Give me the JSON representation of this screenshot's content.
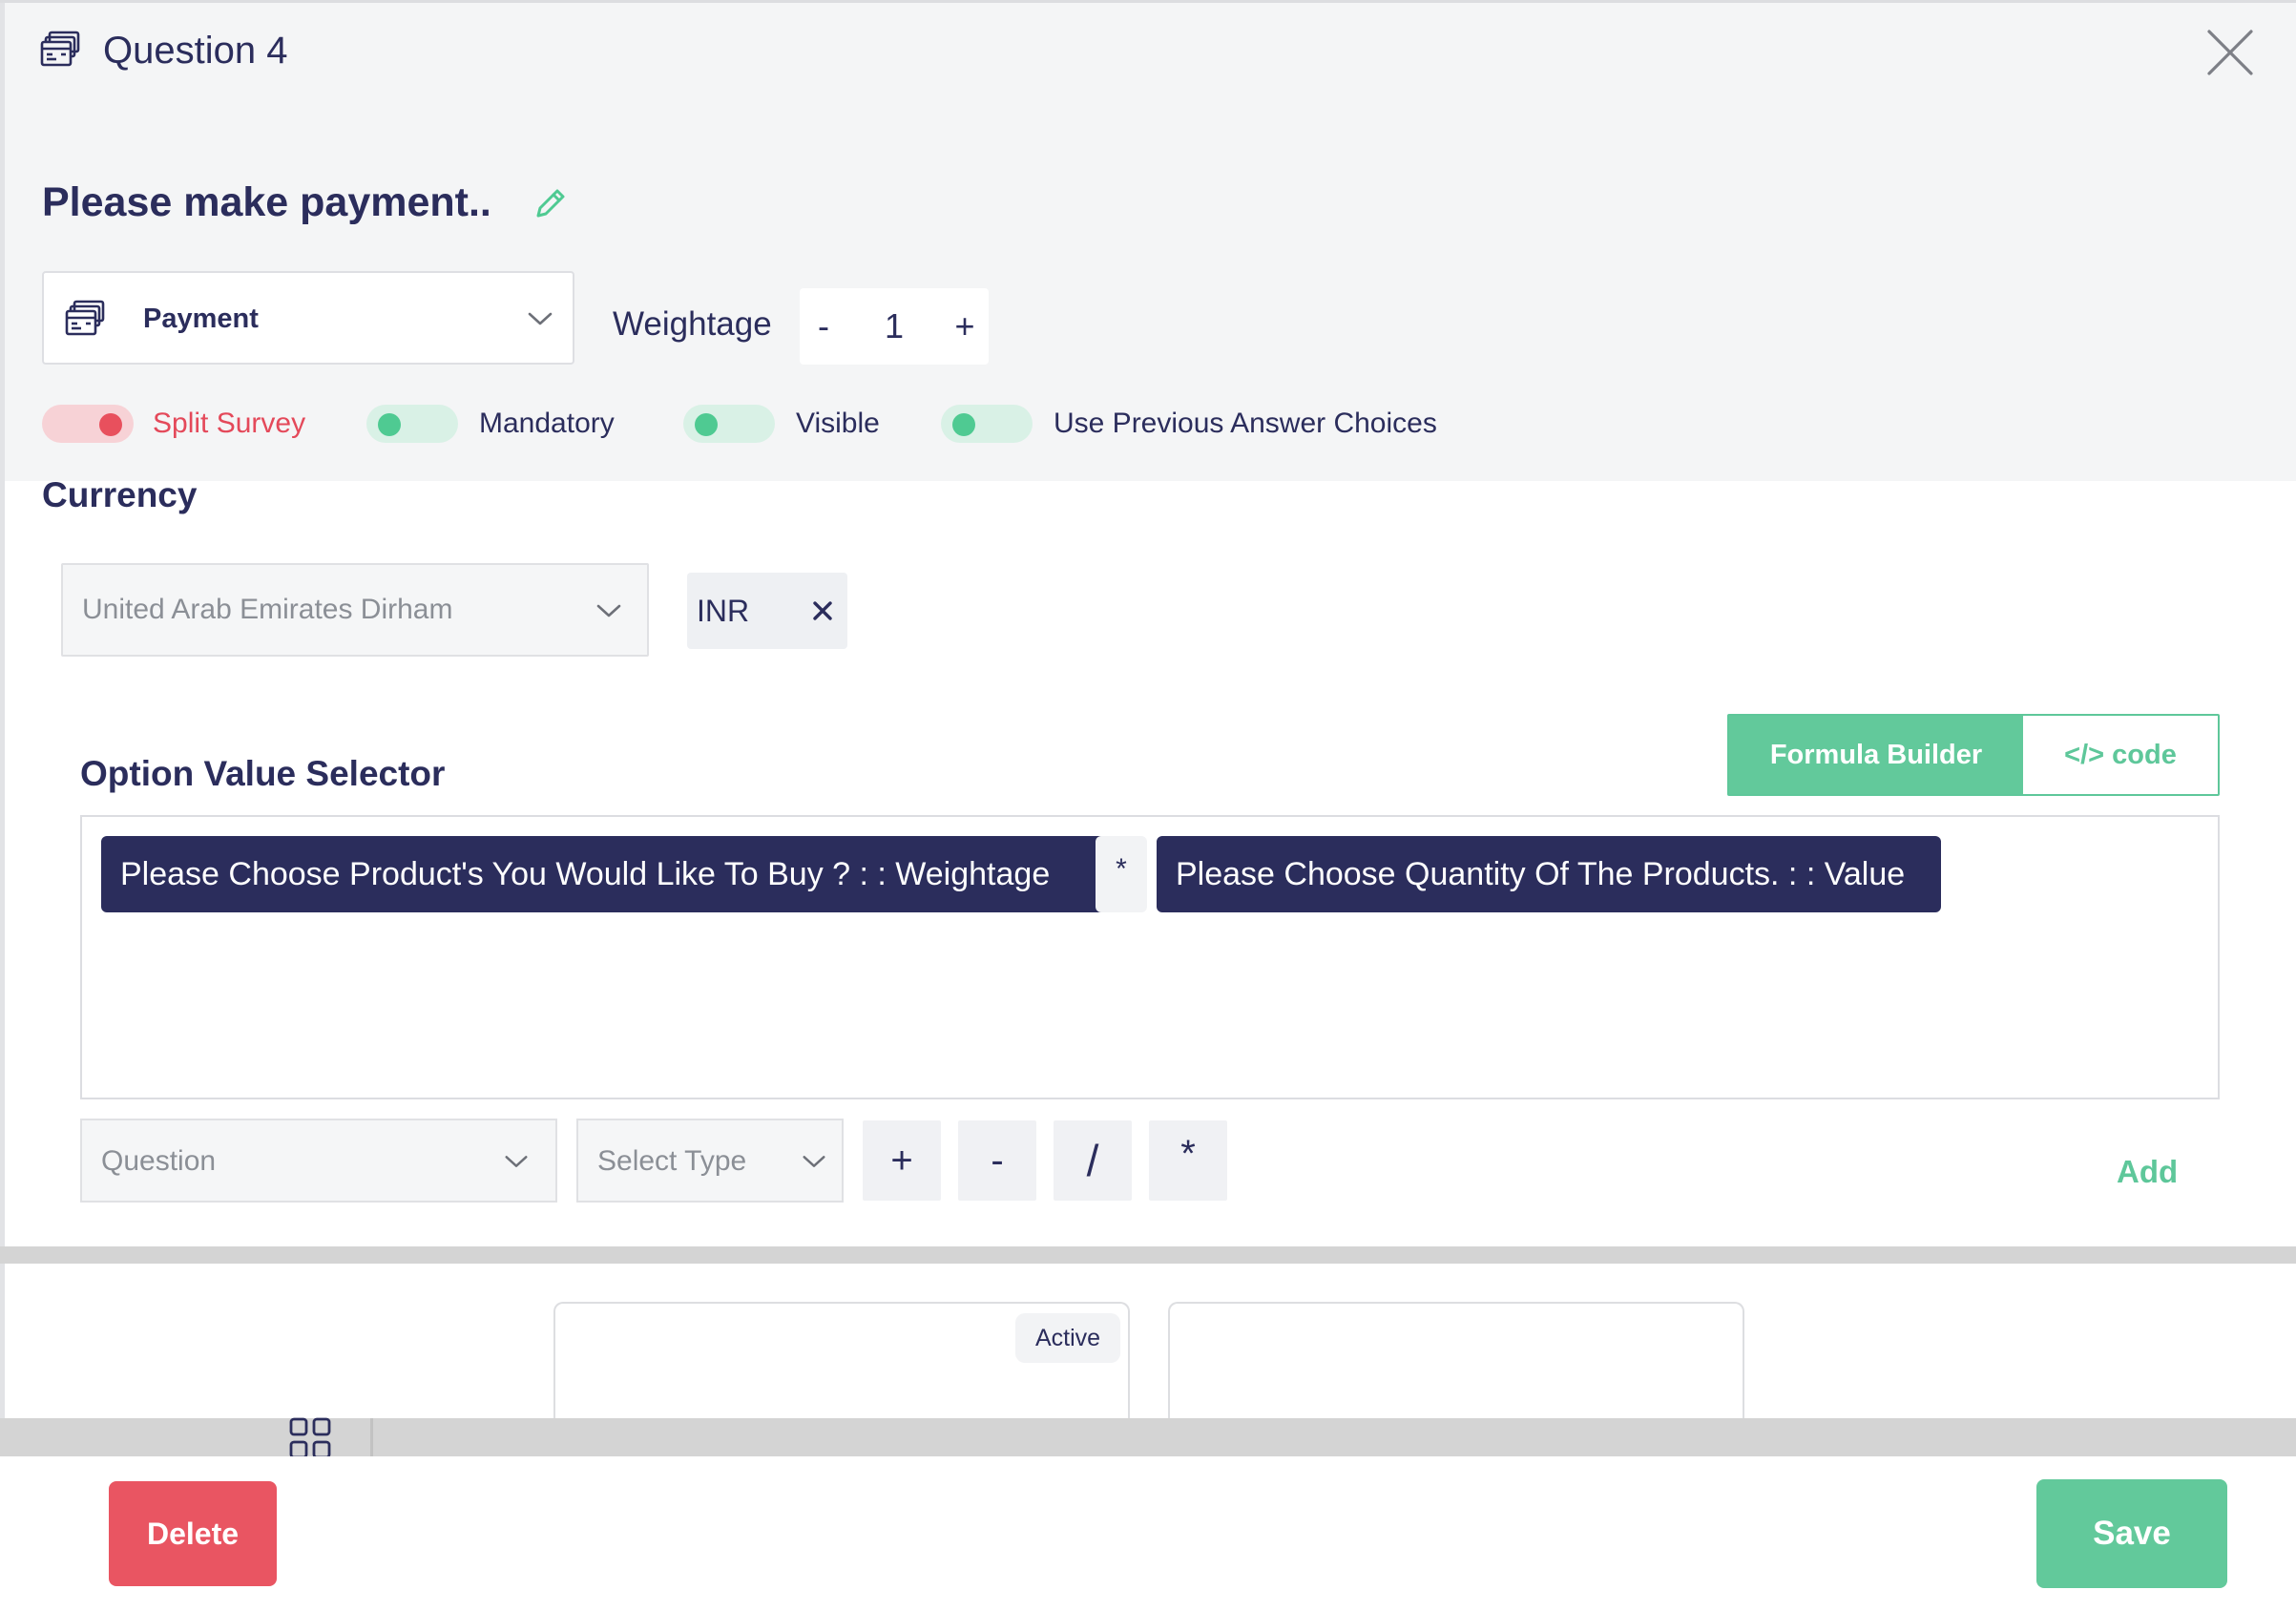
{
  "modal": {
    "title": "Question 4",
    "title_icon": "payment-card-icon",
    "close_icon": "close-icon"
  },
  "question": {
    "text": "Please make payment..",
    "edit_icon": "pencil-icon"
  },
  "question_type": {
    "label": "Payment",
    "icon": "payment-card-icon"
  },
  "weightage": {
    "label": "Weightage",
    "minus": "-",
    "value": "1",
    "plus": "+"
  },
  "toggles": {
    "split_survey": {
      "label": "Split Survey",
      "on": true
    },
    "mandatory": {
      "label": "Mandatory",
      "on": false
    },
    "visible": {
      "label": "Visible",
      "on": false
    },
    "use_previous": {
      "label": "Use Previous Answer Choices",
      "on": false
    }
  },
  "currency": {
    "heading": "Currency",
    "selected": "United Arab Emirates Dirham",
    "tag": "INR"
  },
  "option_value_selector": {
    "heading": "Option Value Selector",
    "mode_formula": "Formula Builder",
    "mode_code": "</> code",
    "formula": {
      "operand_1": "Please Choose Product's You Would Like To Buy ? : : Weightage",
      "operator": "*",
      "operand_2": "Please Choose Quantity Of The Products. : : Value"
    },
    "builder": {
      "question_placeholder": "Question",
      "type_placeholder": "Select Type",
      "operators": [
        "+",
        "-",
        "/",
        "*"
      ],
      "add_label": "Add"
    }
  },
  "background": {
    "card_badge": "Active"
  },
  "footer": {
    "delete_label": "Delete",
    "save_label": "Save"
  },
  "colors": {
    "navy": "#2b2d5c",
    "green": "#62c99b",
    "red": "#e95562",
    "light_bg": "#f4f5f6"
  }
}
